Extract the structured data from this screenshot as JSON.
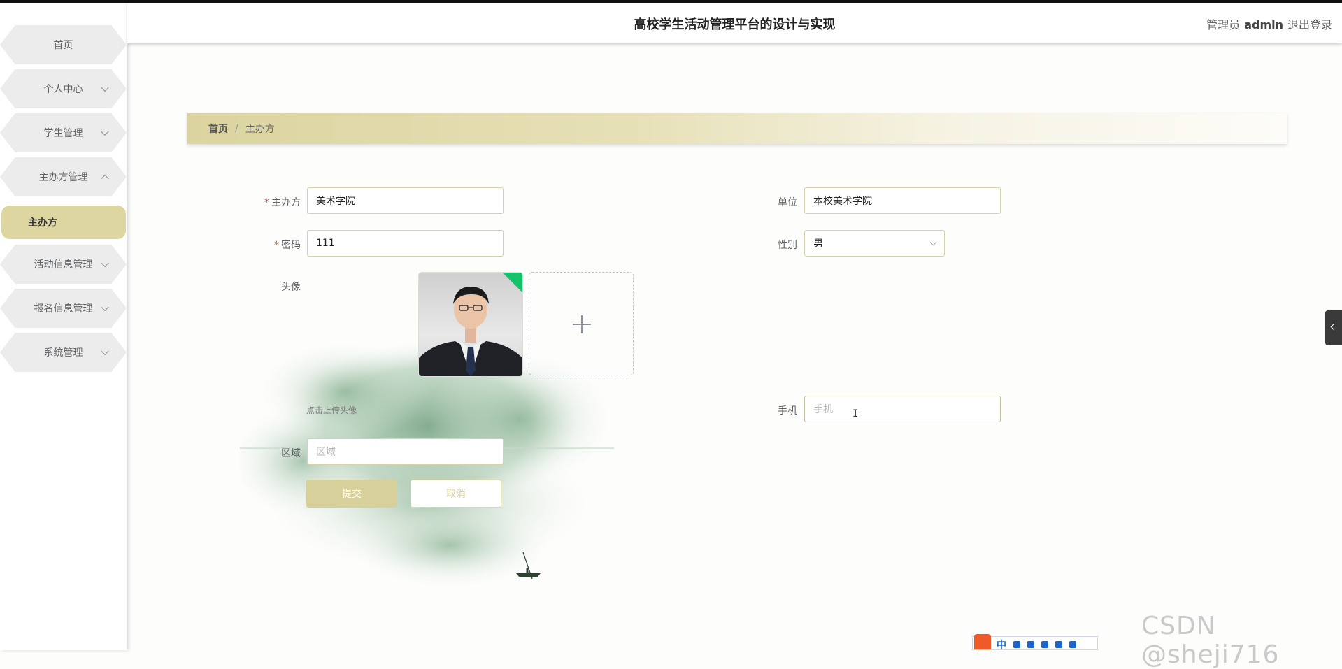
{
  "header": {
    "title": "高校学生活动管理平台的设计与实现",
    "role": "管理员",
    "username": "admin",
    "logout": "退出登录"
  },
  "sidebar": {
    "items": [
      {
        "label": "首页"
      },
      {
        "label": "个人中心"
      },
      {
        "label": "学生管理"
      },
      {
        "label": "主办方管理"
      },
      {
        "label": "活动信息管理"
      },
      {
        "label": "报名信息管理"
      },
      {
        "label": "系统管理"
      }
    ],
    "active_sub": "主办方"
  },
  "breadcrumb": {
    "home": "首页",
    "separator": "/",
    "current": "主办方"
  },
  "form": {
    "organizer": {
      "label": "主办方",
      "value": "美术学院"
    },
    "unit": {
      "label": "单位",
      "value": "本校美术学院"
    },
    "password": {
      "label": "密码",
      "value": "111"
    },
    "gender": {
      "label": "性别",
      "value": "男"
    },
    "avatar": {
      "label": "头像",
      "hint": "点击上传头像"
    },
    "phone": {
      "label": "手机",
      "placeholder": "手机"
    },
    "region": {
      "label": "区域",
      "placeholder": "区域"
    },
    "submit": "提交",
    "cancel": "取消"
  },
  "watermark": "CSDN @sheji716",
  "ime": {
    "label": "中"
  },
  "colors": {
    "accent": "#d8d09a",
    "active_nav": "#ddd6a0",
    "required": "#e5534b",
    "avatar_badge": "#13c269"
  }
}
